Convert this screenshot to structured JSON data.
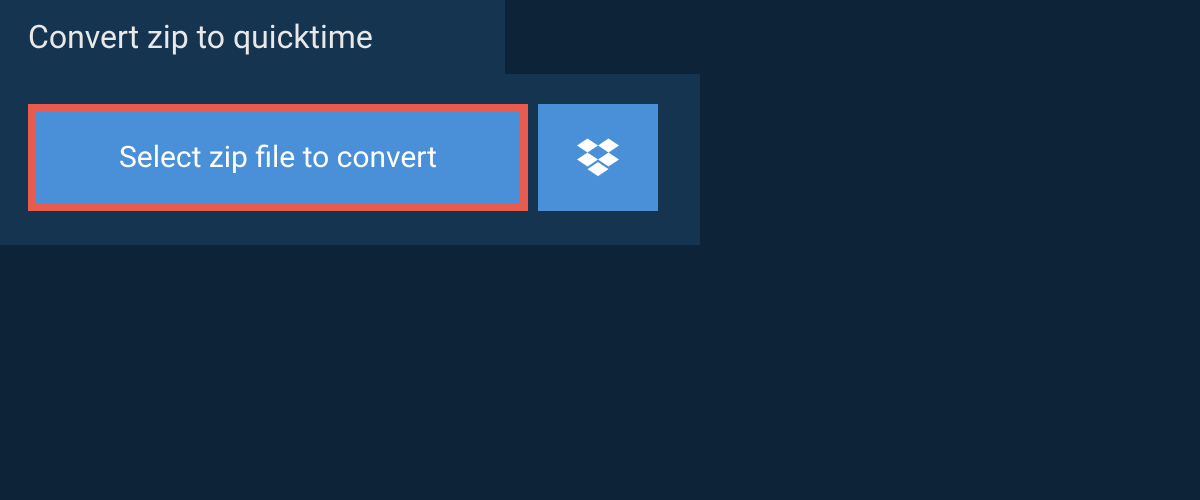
{
  "header": {
    "title": "Convert zip to quicktime"
  },
  "converter": {
    "select_button_label": "Select zip file to convert"
  },
  "colors": {
    "page_bg": "#0d2438",
    "panel_bg": "#153450",
    "button_blue": "#4a90d9",
    "highlight_border": "#e85b4e",
    "text_light": "#e8e8e8"
  },
  "icons": {
    "dropbox": "dropbox-icon"
  }
}
